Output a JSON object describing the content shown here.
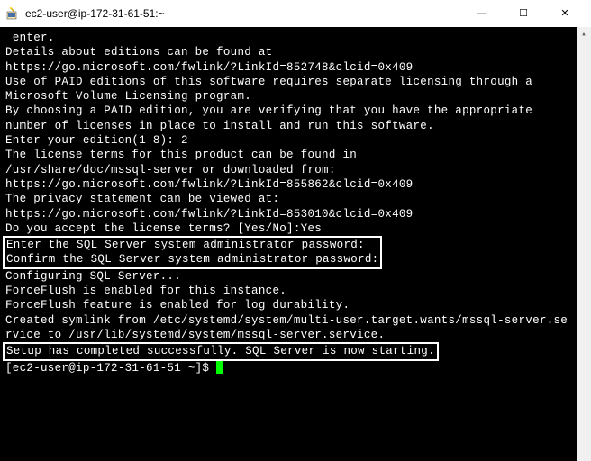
{
  "titlebar": {
    "title": "ec2-user@ip-172-31-61-51:~",
    "minimize": "—",
    "maximize": "☐",
    "close": "✕"
  },
  "terminal": {
    "lines": [
      " enter.",
      "",
      "Details about editions can be found at",
      "https://go.microsoft.com/fwlink/?LinkId=852748&clcid=0x409",
      "",
      "Use of PAID editions of this software requires separate licensing through a",
      "Microsoft Volume Licensing program.",
      "By choosing a PAID edition, you are verifying that you have the appropriate",
      "number of licenses in place to install and run this software.",
      "",
      "Enter your edition(1-8): 2",
      "The license terms for this product can be found in",
      "/usr/share/doc/mssql-server or downloaded from:",
      "https://go.microsoft.com/fwlink/?LinkId=855862&clcid=0x409",
      "",
      "The privacy statement can be viewed at:",
      "https://go.microsoft.com/fwlink/?LinkId=853010&clcid=0x409",
      "",
      "Do you accept the license terms? [Yes/No]:Yes",
      ""
    ],
    "box1_line1": "Enter the SQL Server system administrator password:",
    "box1_line2": "Confirm the SQL Server system administrator password:",
    "mid_lines": [
      "Configuring SQL Server...",
      "",
      "ForceFlush is enabled for this instance.",
      "ForceFlush feature is enabled for log durability.",
      "Created symlink from /etc/systemd/system/multi-user.target.wants/mssql-server.se",
      "rvice to /usr/lib/systemd/system/mssql-server.service."
    ],
    "box2": "Setup has completed successfully. SQL Server is now starting.",
    "prompt": "[ec2-user@ip-172-31-61-51 ~]$ "
  }
}
